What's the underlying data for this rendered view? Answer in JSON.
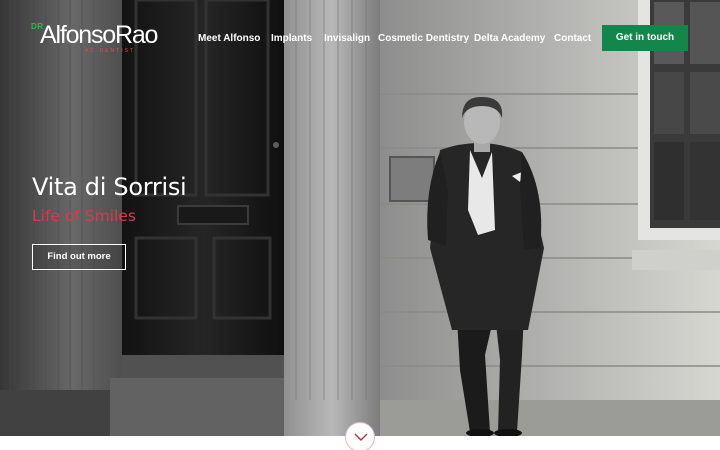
{
  "logo": {
    "prefix": "DR",
    "name": "AlfonsoRao",
    "tagline": "AC·DENTIST"
  },
  "nav": {
    "items": [
      {
        "label": "Meet Alfonso"
      },
      {
        "label": "Implants"
      },
      {
        "label": "Invisalign"
      },
      {
        "label": "Cosmetic Dentistry"
      },
      {
        "label": "Delta Academy"
      },
      {
        "label": "Contact"
      }
    ],
    "cta_label": "Get in touch"
  },
  "hero": {
    "title": "Vita di Sorrisi",
    "subtitle": "Life of Smiles",
    "button_label": "Find out more",
    "photo_icon": "portrait-photo-icon"
  },
  "scroll": {
    "icon": "chevron-down-icon"
  },
  "colors": {
    "brand_green": "#13864b",
    "logo_dr_green": "#3bb54a",
    "accent_red": "#d93a4b",
    "text_white": "#ffffff"
  }
}
